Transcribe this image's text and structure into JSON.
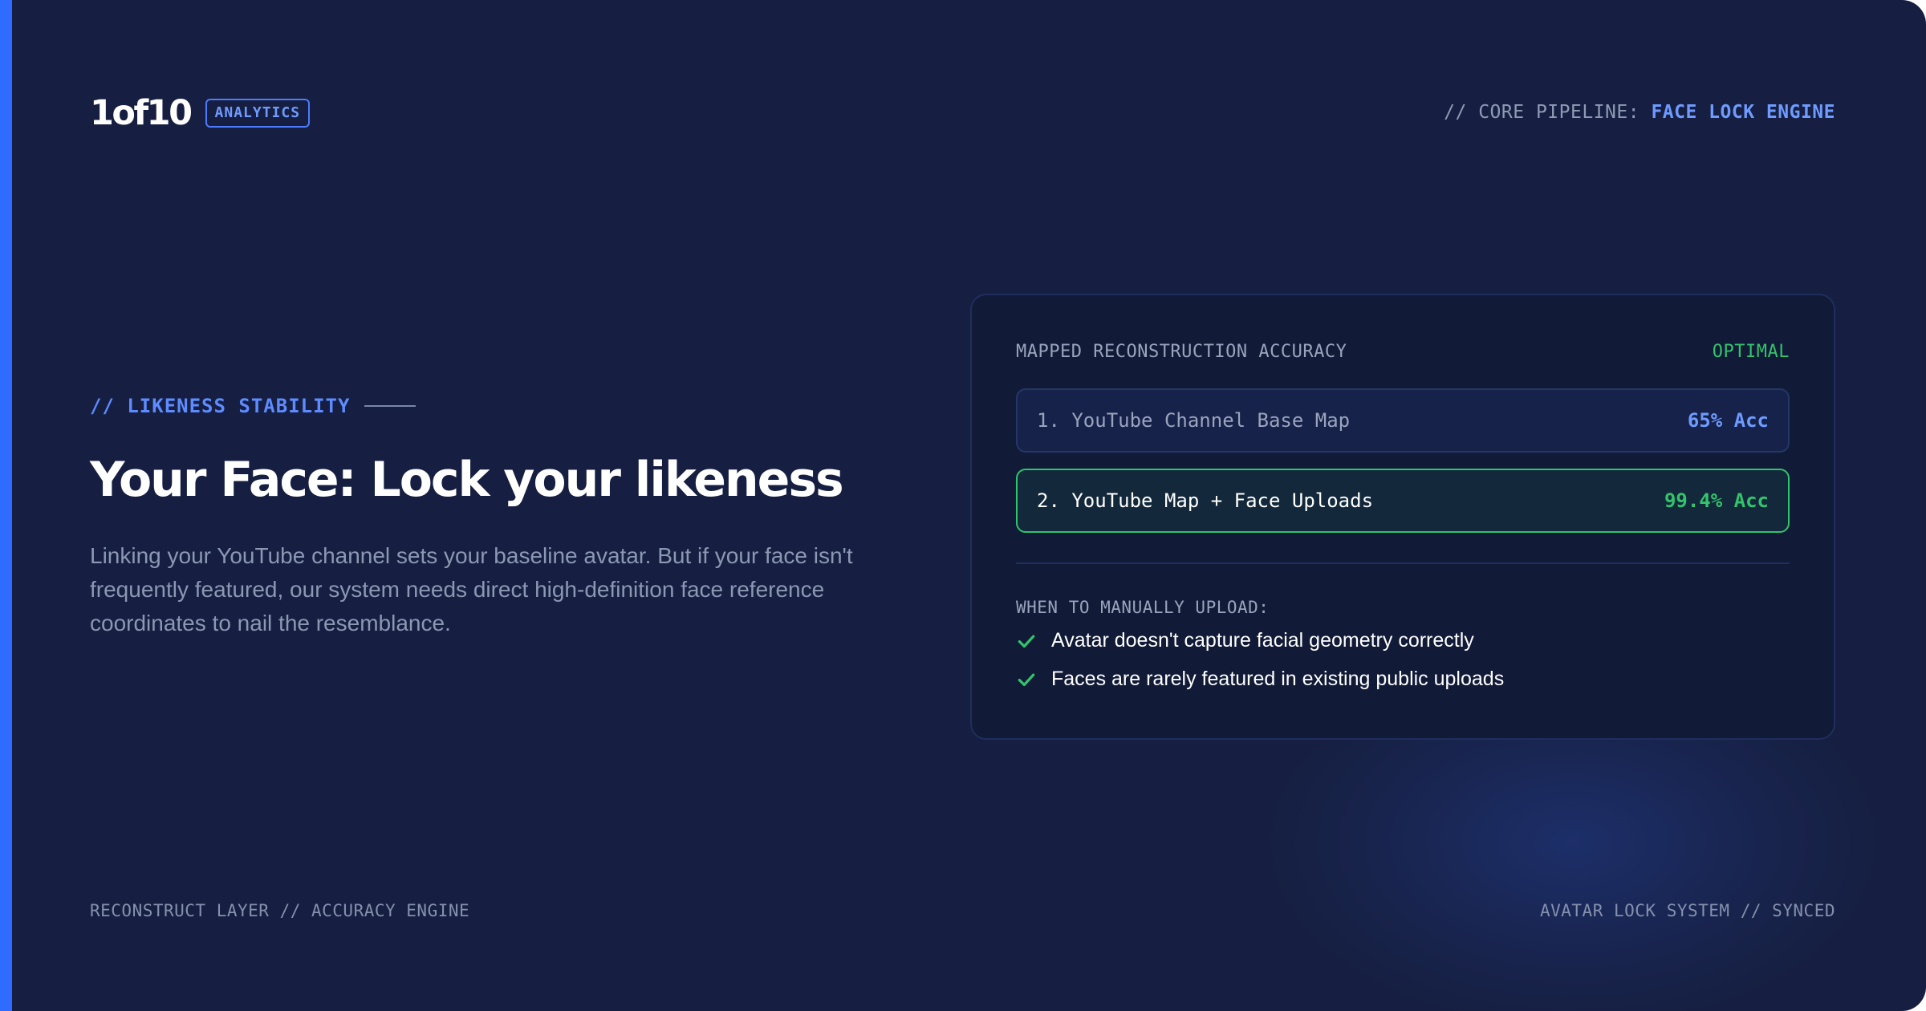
{
  "header": {
    "logo": "1of10",
    "badge": "ANALYTICS",
    "pipeline_prefix": "// CORE PIPELINE:",
    "pipeline_value": "FACE LOCK ENGINE"
  },
  "hero": {
    "eyebrow": "// LIKENESS STABILITY",
    "headline": "Your Face: Lock your likeness",
    "description": "Linking your YouTube channel sets your baseline avatar. But if your face isn't frequently featured, our system needs direct high-definition face reference coordinates to nail the resemblance."
  },
  "card": {
    "title": "MAPPED RECONSTRUCTION ACCURACY",
    "status": "OPTIMAL",
    "maps": [
      {
        "label": "1. YouTube Channel Base Map",
        "value": "65% Acc"
      },
      {
        "label": "2. YouTube Map + Face Uploads",
        "value": "99.4% Acc"
      }
    ],
    "when_title": "WHEN TO MANUALLY UPLOAD:",
    "checks": [
      "Avatar doesn't capture facial geometry correctly",
      "Faces are rarely featured in existing public uploads"
    ]
  },
  "footer": {
    "left": "RECONSTRUCT LAYER // ACCURACY ENGINE",
    "right": "AVATAR LOCK SYSTEM // SYNCED"
  },
  "colors": {
    "background": "#161f41",
    "accent": "#2f6bff",
    "highlight_blue": "#6f9bff",
    "success_green": "#32c46c"
  },
  "icons": {
    "check": "check-icon"
  }
}
